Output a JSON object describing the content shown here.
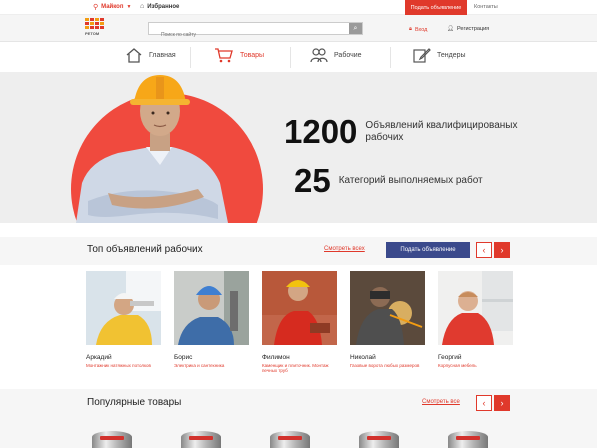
{
  "topbar": {
    "city": "Майкоп",
    "favorites": "Избранное",
    "post_ad": "Подать объявление",
    "contacts": "Контакты"
  },
  "header": {
    "logo_text": "PETOM",
    "search_placeholder": "Поиск по сайту",
    "login": "Вход",
    "register": "Регистрация"
  },
  "nav": [
    {
      "label": "Главная",
      "icon": "home-icon"
    },
    {
      "label": "Товары",
      "icon": "cart-icon",
      "active": true
    },
    {
      "label": "Рабочие",
      "icon": "workers-icon"
    },
    {
      "label": "Тендеры",
      "icon": "edit-icon"
    }
  ],
  "hero": {
    "stat1_number": "1200",
    "stat1_text": "Объявлений квалифицированых рабочих",
    "stat2_number": "25",
    "stat2_text": "Категорий выполняемых работ"
  },
  "top_workers": {
    "title": "Топ объявлений рабочих",
    "see_all": "Смотреть всех",
    "post_button": "Подать объявление",
    "workers": [
      {
        "name": "Аркадий",
        "desc": "Монтажник натяжных потолков"
      },
      {
        "name": "Борис",
        "desc": "Электрика и сантехника"
      },
      {
        "name": "Филимон",
        "desc": "Каменщик и плиточник. Монтаж печных труб"
      },
      {
        "name": "Николай",
        "desc": "Газовые ворота любых размеров"
      },
      {
        "name": "Георгий",
        "desc": "Корпусная мебель"
      }
    ]
  },
  "popular": {
    "title": "Популярные товары",
    "see_all": "Смотреть все"
  },
  "colors": {
    "accent": "#e0392b",
    "button_blue": "#3b4a8c",
    "hero_bg": "#eeeeee"
  }
}
